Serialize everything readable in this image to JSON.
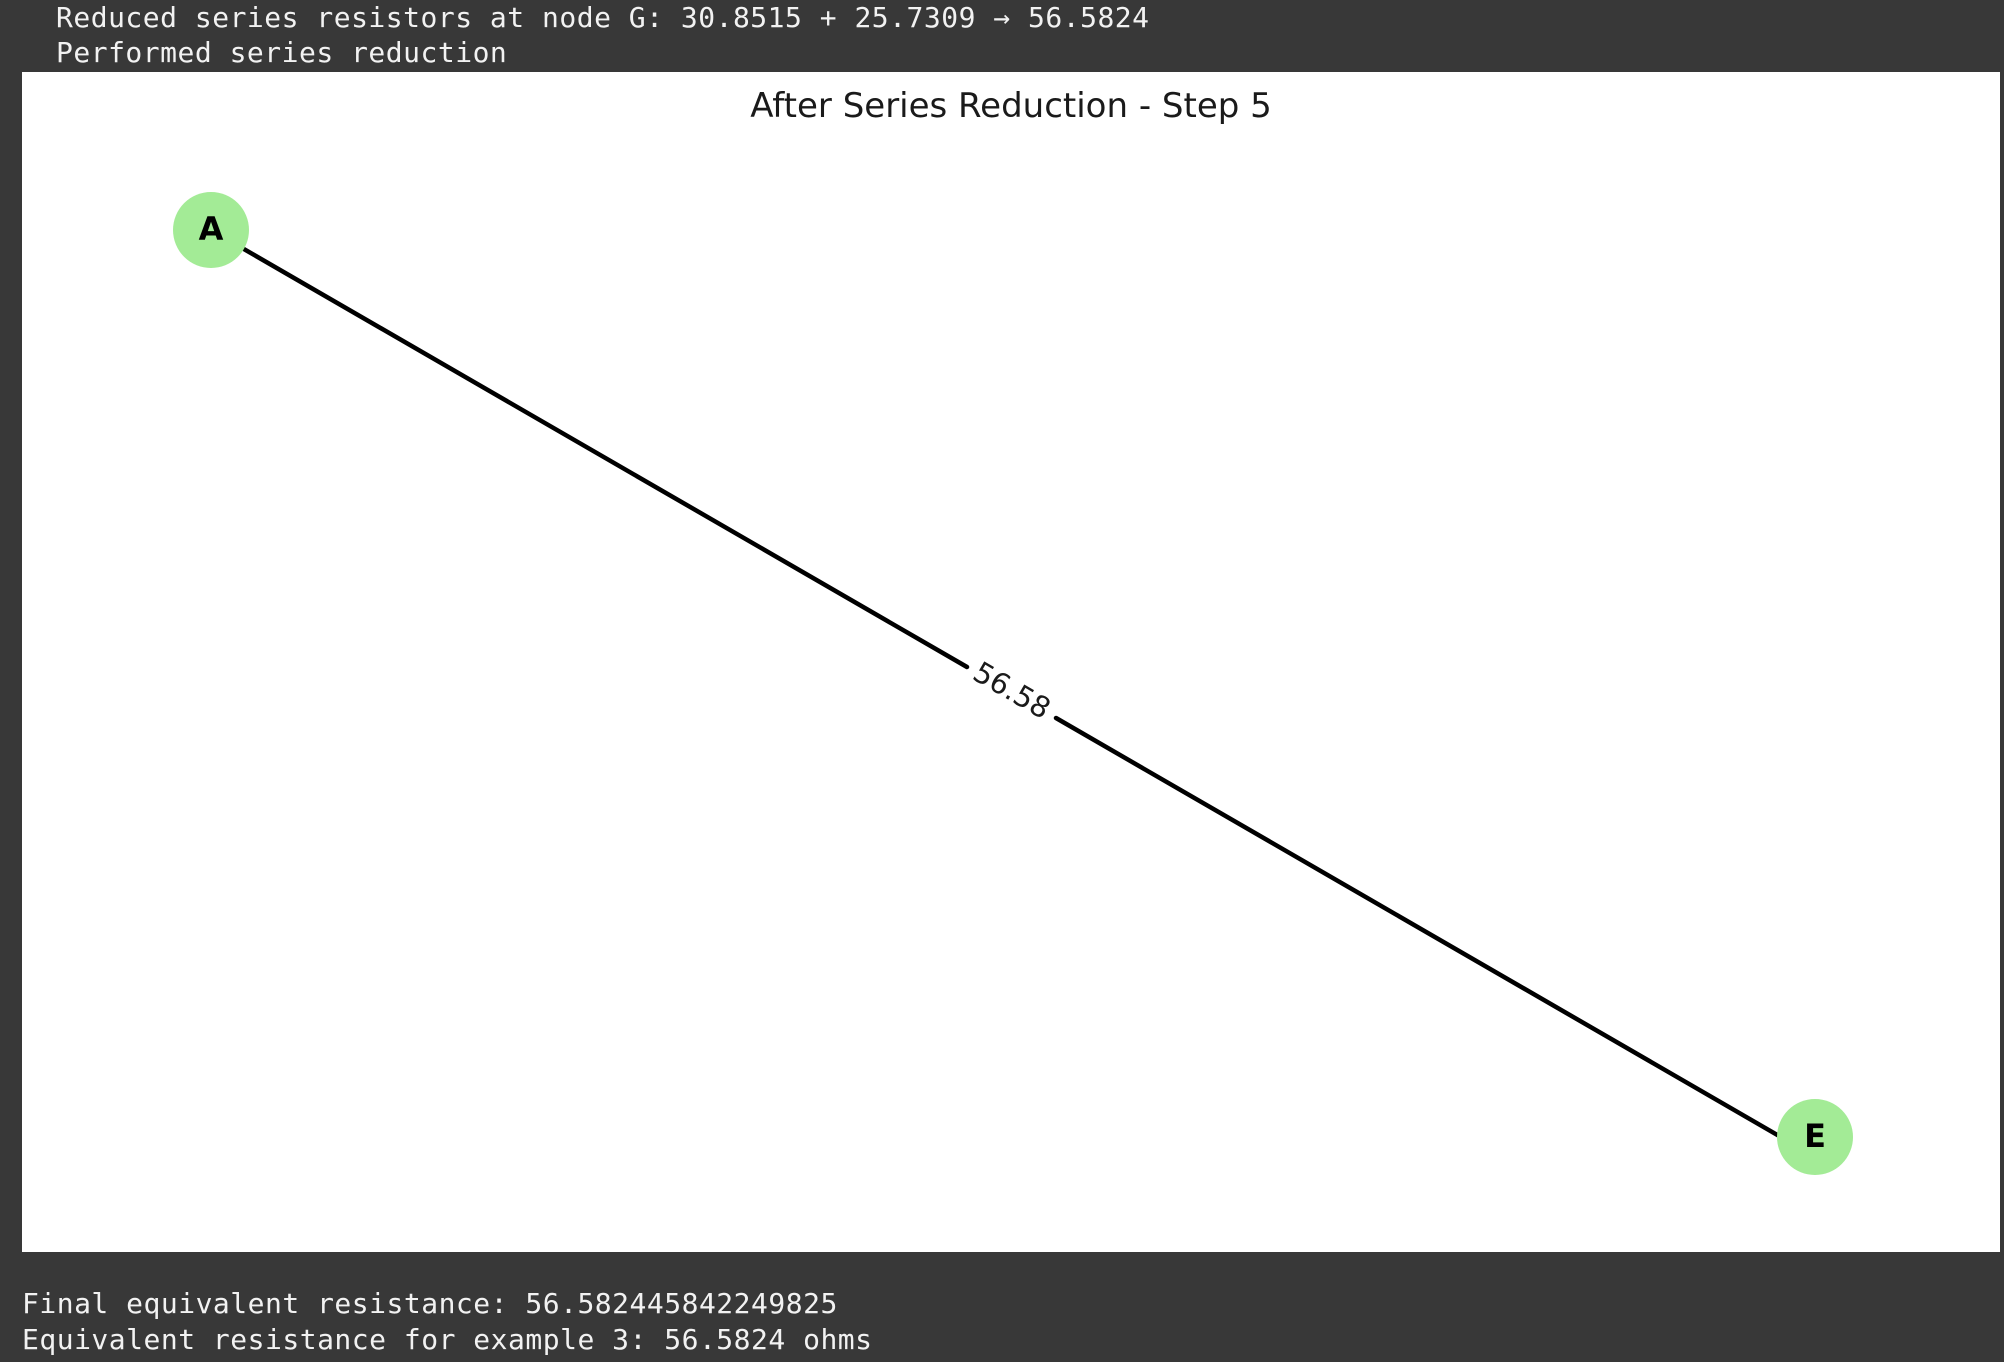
{
  "console": {
    "pre_lines": [
      "Reduced series resistors at node G: 30.8515 + 25.7309 → 56.5824",
      "Performed series reduction"
    ],
    "post_lines": [
      "Final equivalent resistance: 56.582445842249825",
      "Equivalent resistance for example 3: 56.5824 ohms"
    ]
  },
  "figure": {
    "title": "After Series Reduction - Step 5",
    "nodes": [
      {
        "id": "A",
        "label": "A"
      },
      {
        "id": "E",
        "label": "E"
      }
    ],
    "edges": [
      {
        "source": "A",
        "target": "E",
        "label": "56.58"
      }
    ],
    "colors": {
      "node_fill": "#a3eb96",
      "edge": "#000000",
      "background": "#ffffff",
      "console_background": "#383838",
      "console_text": "#f2f2f2"
    }
  }
}
